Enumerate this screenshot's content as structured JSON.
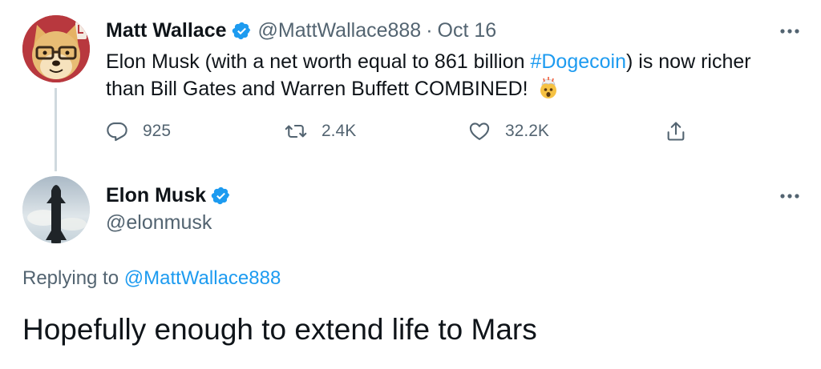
{
  "parent_tweet": {
    "author_name": "Matt Wallace",
    "handle": "@MattWallace888",
    "separator": "·",
    "date": "Oct 16",
    "text_before_hashtag": "Elon Musk (with a net worth equal to 861 billion ",
    "hashtag": "#Dogecoin",
    "text_after_hashtag": ") is now richer than Bill Gates and Warren Buffett COMBINED!",
    "emoji": "exploding-head-emoji",
    "replies": "925",
    "retweets": "2.4K",
    "likes": "32.2K"
  },
  "reply_tweet": {
    "author_name": "Elon Musk",
    "handle": "@elonmusk",
    "replying_prefix": "Replying to ",
    "replying_to": "@MattWallace888",
    "text": "Hopefully enough to extend life to Mars"
  },
  "icons": {
    "verified": "verified-badge-icon",
    "more": "more-options-icon",
    "reply": "reply-icon",
    "retweet": "retweet-icon",
    "like": "heart-icon",
    "share": "share-icon"
  },
  "colors": {
    "link": "#1d9bf0",
    "secondary_text": "#536471",
    "primary_text": "#0f1419",
    "thread_line": "#cfd9de"
  }
}
